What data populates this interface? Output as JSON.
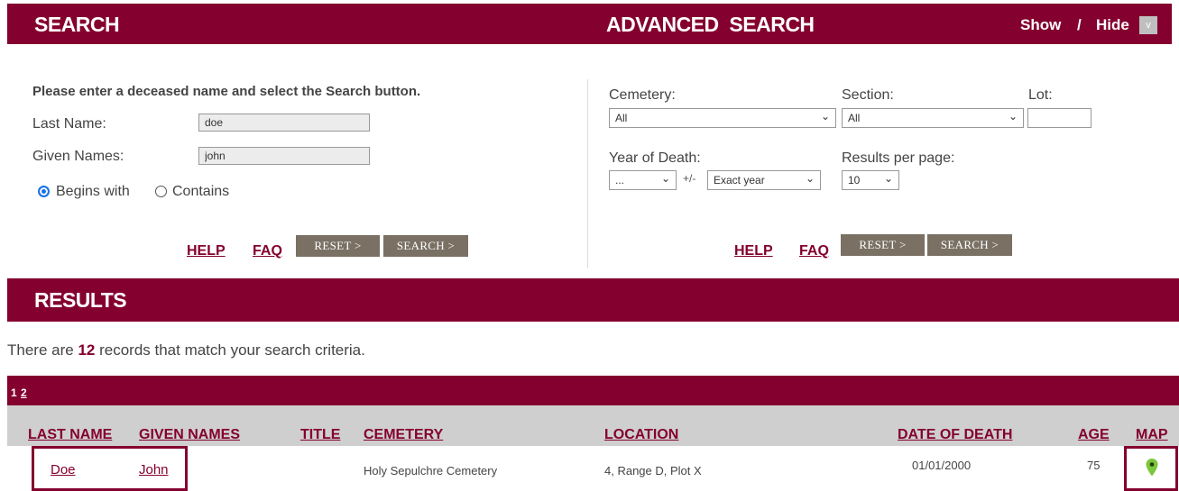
{
  "search_header": {
    "title": "SEARCH"
  },
  "advanced_header": {
    "title": "ADVANCED  SEARCH",
    "show": "Show",
    "sep": "/",
    "hide": "Hide",
    "toggle": "v"
  },
  "basic": {
    "instructions": "Please enter a deceased name and select the Search button.",
    "last_name_label": "Last Name:",
    "last_name_value": "doe",
    "given_label": "Given Names:",
    "given_value": "john",
    "begins_with": "Begins with",
    "contains": "Contains",
    "help": "HELP",
    "faq": "FAQ",
    "reset": "RESET >",
    "search": "SEARCH >"
  },
  "advanced": {
    "cemetery_label": "Cemetery:",
    "cemetery_value": "All",
    "section_label": "Section:",
    "section_value": "All",
    "lot_label": "Lot:",
    "year_label": "Year of Death:",
    "year_value": "...",
    "plusminus": "+/-",
    "range_value": "Exact year",
    "per_page_label": "Results per page:",
    "per_page_value": "10",
    "help": "HELP",
    "faq": "FAQ",
    "reset": "RESET >",
    "search": "SEARCH >"
  },
  "results": {
    "title": "RESULTS",
    "summary_pre": "There are ",
    "count": "12",
    "summary_post": " records that match your search criteria.",
    "pages": [
      "1",
      "2"
    ],
    "columns": {
      "last_name": "LAST NAME",
      "given_names": "GIVEN NAMES",
      "title": "TITLE",
      "cemetery": "CEMETERY",
      "location": "LOCATION",
      "date_of_death": "DATE OF DEATH",
      "age": "AGE",
      "map": "MAP"
    },
    "rows": [
      {
        "last_name": "Doe",
        "given_names": "John",
        "title": "",
        "cemetery": "Holy Sepulchre Cemetery",
        "location": "4, Range D, Plot X",
        "date_of_death": "01/01/2000",
        "age": "75",
        "map_icon": "map-pin-icon"
      }
    ]
  },
  "colors": {
    "brand": "#84002e",
    "button": "#7a7064",
    "table_header": "#cfcfcf",
    "pin": "#7cc63b"
  }
}
